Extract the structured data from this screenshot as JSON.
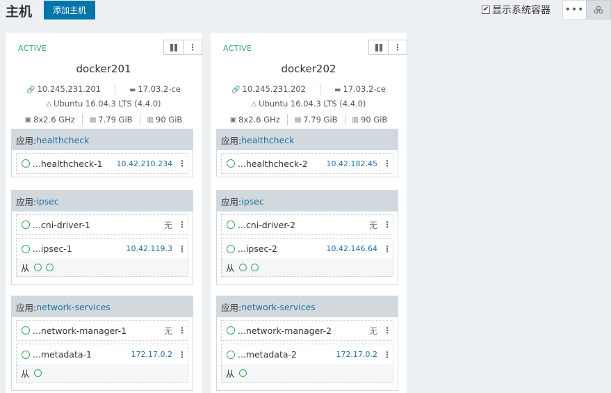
{
  "header": {
    "title": "主机",
    "add_host_label": "添加主机",
    "show_system_label": "显示系统容器",
    "show_system_checked": true,
    "more_label": "•••",
    "group_icon": "group-icon"
  },
  "colors": {
    "accent": "#0075a8",
    "active": "#2ea85d",
    "link": "#1f6fa0"
  },
  "hosts": [
    {
      "state": "ACTIVE",
      "name": "docker201",
      "ip": "10.245.231.201",
      "docker": "17.03.2-ce",
      "os": "Ubuntu 16.04.3 LTS (4.4.0)",
      "cpu": "8x2.6 GHz",
      "memory": "7.79 GiB",
      "storage": "90 GiB",
      "stacks": [
        {
          "prefix": "应用: ",
          "name": "healthcheck",
          "containers": [
            {
              "name": "...healthcheck-1",
              "ip": "10.42.210.234"
            }
          ],
          "sidekick": null
        },
        {
          "prefix": "应用: ",
          "name": "ipsec",
          "containers": [
            {
              "name": "...cni-driver-1",
              "ip": "无"
            },
            {
              "name": "...ipsec-1",
              "ip": "10.42.119.3"
            }
          ],
          "sidekick": {
            "label": "从"
          }
        },
        {
          "prefix": "应用: ",
          "name": "network-services",
          "containers": [
            {
              "name": "...network-manager-1",
              "ip": "无"
            },
            {
              "name": "...metadata-1",
              "ip": "172.17.0.2"
            }
          ],
          "sidekick": {
            "label": "从"
          }
        }
      ]
    },
    {
      "state": "ACTIVE",
      "name": "docker202",
      "ip": "10.245.231.202",
      "docker": "17.03.2-ce",
      "os": "Ubuntu 16.04.3 LTS (4.4.0)",
      "cpu": "8x2.6 GHz",
      "memory": "7.79 GiB",
      "storage": "90 GiB",
      "stacks": [
        {
          "prefix": "应用: ",
          "name": "healthcheck",
          "containers": [
            {
              "name": "...healthcheck-2",
              "ip": "10.42.182.45"
            }
          ],
          "sidekick": null
        },
        {
          "prefix": "应用: ",
          "name": "ipsec",
          "containers": [
            {
              "name": "...cni-driver-2",
              "ip": "无"
            },
            {
              "name": "...ipsec-2",
              "ip": "10.42.146.64"
            }
          ],
          "sidekick": {
            "label": "从"
          }
        },
        {
          "prefix": "应用: ",
          "name": "network-services",
          "containers": [
            {
              "name": "...network-manager-2",
              "ip": "无"
            },
            {
              "name": "...metadata-2",
              "ip": "172.17.0.2"
            }
          ],
          "sidekick": {
            "label": "从"
          }
        }
      ]
    }
  ]
}
